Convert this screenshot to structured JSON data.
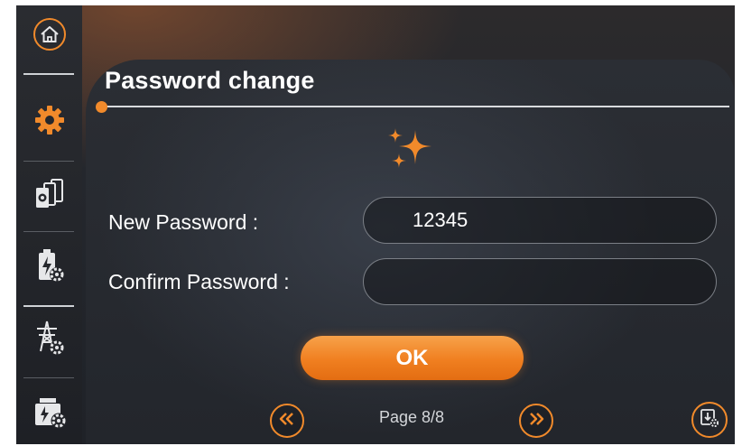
{
  "screen": {
    "title": "Password change"
  },
  "sidebar": {
    "items": [
      {
        "name": "home",
        "icon": "home-icon",
        "active": false
      },
      {
        "name": "settings",
        "icon": "gear-icon",
        "active": true
      },
      {
        "name": "devices",
        "icon": "device-stack-gear-icon",
        "active": false
      },
      {
        "name": "battery",
        "icon": "battery-gear-icon",
        "active": false
      },
      {
        "name": "grid",
        "icon": "power-tower-gear-icon",
        "active": false
      },
      {
        "name": "generator",
        "icon": "generator-gear-icon",
        "active": false
      }
    ]
  },
  "form": {
    "new_password_label": "New Password :",
    "new_password_value": "12345",
    "confirm_password_label": "Confirm Password :",
    "confirm_password_value": "",
    "ok_label": "OK"
  },
  "pagination": {
    "text": "Page 8/8",
    "prev_icon": "double-chevron-left-icon",
    "next_icon": "double-chevron-right-icon"
  },
  "colors": {
    "accent": "#f18a2b",
    "background": "#1b1d22",
    "text": "#ffffff"
  }
}
